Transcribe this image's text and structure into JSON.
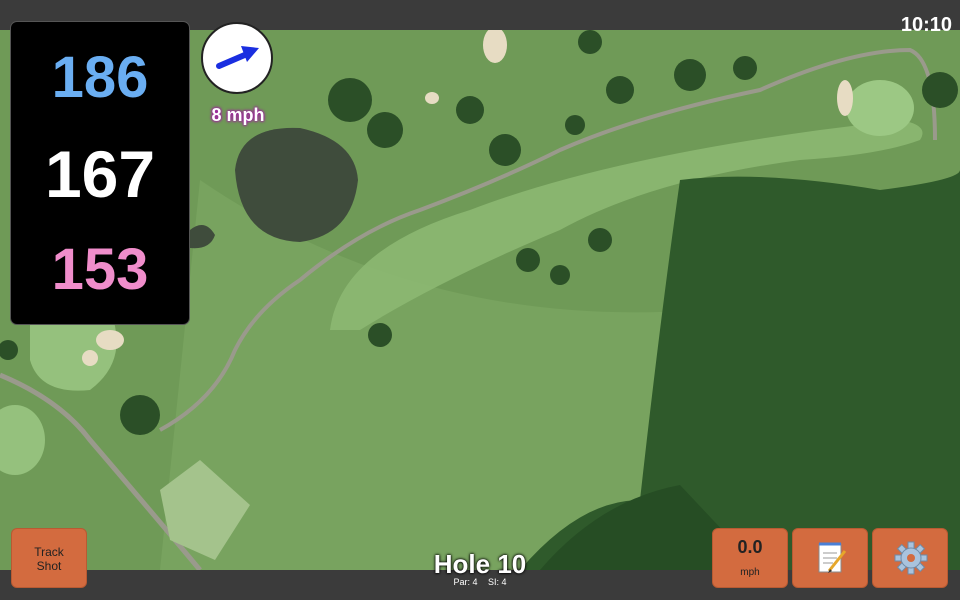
{
  "clock": "10:10",
  "distances": {
    "back": "186",
    "center": "167",
    "front": "153"
  },
  "wind": {
    "speed": "8 mph",
    "direction_icon": "wind-arrow-icon"
  },
  "buttons": {
    "track_shot_line1": "Track",
    "track_shot_line2": "Shot",
    "speed_value": "0.0",
    "speed_unit": "mph",
    "notes_icon": "notepad-icon",
    "settings_icon": "gear-icon"
  },
  "hole": {
    "title": "Hole 10",
    "par": "Par: 4",
    "si": "SI: 4"
  },
  "colors": {
    "back": "#6aaef2",
    "center": "#ffffff",
    "front": "#f08dcb",
    "button": "#d36b3f",
    "wind_label_glow": "#a01fa0"
  }
}
